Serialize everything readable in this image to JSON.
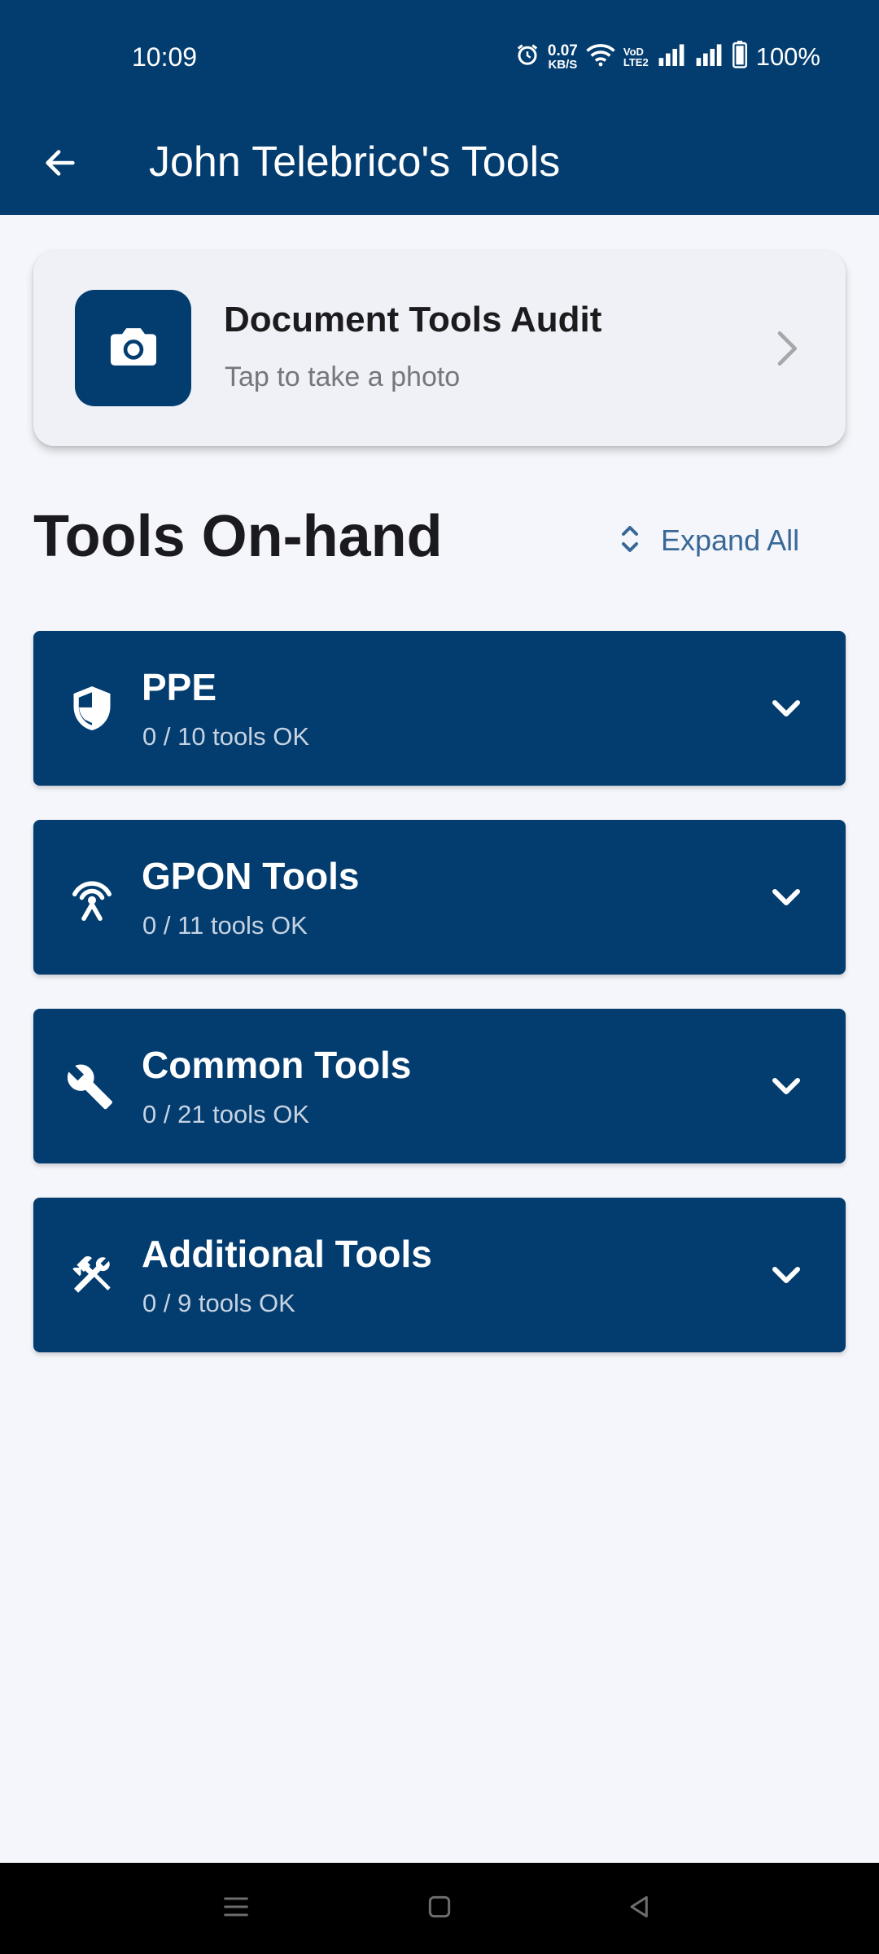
{
  "status_bar": {
    "time": "10:09",
    "net_speed_value": "0.07",
    "net_speed_unit": "KB/S",
    "volte_top": "VoD",
    "volte_bottom": "LTE2",
    "battery_percent": "100%",
    "icons": [
      "alarm-icon",
      "wifi-icon",
      "signal-icon",
      "signal-icon",
      "battery-icon"
    ]
  },
  "app_bar": {
    "title": "John Telebrico's Tools",
    "back_icon": "arrow-left-icon"
  },
  "audit_card": {
    "title": "Document Tools Audit",
    "subtitle": "Tap to take a photo",
    "icon": "camera-icon"
  },
  "section": {
    "title": "Tools On-hand",
    "expand_label": "Expand All"
  },
  "categories": [
    {
      "title": "PPE",
      "count": "0 / 10 tools OK",
      "icon": "shield-icon"
    },
    {
      "title": "GPON Tools",
      "count": "0 / 11 tools OK",
      "icon": "antenna-icon"
    },
    {
      "title": "Common Tools",
      "count": "0 / 21 tools OK",
      "icon": "wrench-icon"
    },
    {
      "title": "Additional Tools",
      "count": "0 / 9 tools OK",
      "icon": "tools-icon"
    }
  ],
  "colors": {
    "primary": "#033d6f",
    "background": "#f4f6fb",
    "card": "#eff1f7",
    "link": "#3a6896"
  }
}
